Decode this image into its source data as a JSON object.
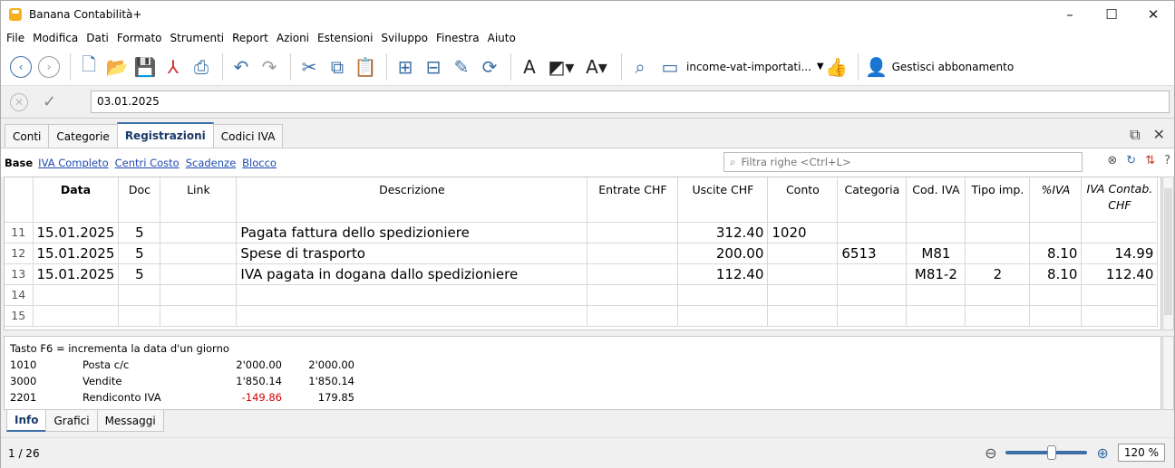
{
  "app": {
    "title": "Banana Contabilità+"
  },
  "window": {
    "minimize": "–",
    "maximize": "☐",
    "close": "✕"
  },
  "menu": [
    "File",
    "Modifica",
    "Dati",
    "Formato",
    "Strumenti",
    "Report",
    "Azioni",
    "Estensioni",
    "Sviluppo",
    "Finestra",
    "Aiuto"
  ],
  "toolbar": {
    "file_dropdown": "income-vat-importati...",
    "manage_subscription": "Gestisci abbonamento"
  },
  "editbar": {
    "value": "03.01.2025"
  },
  "tabs": [
    "Conti",
    "Categorie",
    "Registrazioni",
    "Codici IVA"
  ],
  "active_tab": "Registrazioni",
  "views": {
    "base": "Base",
    "links": [
      "IVA Completo",
      "Centri Costo",
      "Scadenze",
      "Blocco"
    ],
    "filter_placeholder": "Filtra righe <Ctrl+L>"
  },
  "grid": {
    "columns": [
      "Data",
      "Doc",
      "Link",
      "Descrizione",
      "Entrate CHF",
      "Uscite CHF",
      "Conto",
      "Categoria",
      "Cod. IVA",
      "Tipo imp.",
      "%IVA",
      "IVA Contab. CHF"
    ],
    "rows": [
      {
        "n": "11",
        "data": "15.01.2025",
        "doc": "5",
        "link": "",
        "desc": "Pagata fattura dello spedizioniere",
        "entrate": "",
        "uscite": "312.40",
        "conto": "1020",
        "categoria": "",
        "codiva": "",
        "tipo": "",
        "piva": "",
        "ivacontab": ""
      },
      {
        "n": "12",
        "data": "15.01.2025",
        "doc": "5",
        "link": "",
        "desc": "Spese di trasporto",
        "entrate": "",
        "uscite": "200.00",
        "conto": "",
        "categoria": "6513",
        "codiva": "M81",
        "tipo": "",
        "piva": "8.10",
        "ivacontab": "14.99"
      },
      {
        "n": "13",
        "data": "15.01.2025",
        "doc": "5",
        "link": "",
        "desc": "IVA pagata in dogana dallo spedizioniere",
        "entrate": "",
        "uscite": "112.40",
        "conto": "",
        "categoria": "",
        "codiva": "M81-2",
        "tipo": "2",
        "piva": "8.10",
        "ivacontab": "112.40"
      },
      {
        "n": "14",
        "data": "",
        "doc": "",
        "link": "",
        "desc": "",
        "entrate": "",
        "uscite": "",
        "conto": "",
        "categoria": "",
        "codiva": "",
        "tipo": "",
        "piva": "",
        "ivacontab": ""
      },
      {
        "n": "15",
        "data": "",
        "doc": "",
        "link": "",
        "desc": "",
        "entrate": "",
        "uscite": "",
        "conto": "",
        "categoria": "",
        "codiva": "",
        "tipo": "",
        "piva": "",
        "ivacontab": ""
      }
    ]
  },
  "info": {
    "hint": "Tasto F6 = incrementa la data d'un giorno",
    "lines": [
      {
        "acc": "1010",
        "name": "Posta c/c",
        "v1": "2'000.00",
        "v2": "2'000.00",
        "neg": false
      },
      {
        "acc": "3000",
        "name": "Vendite",
        "v1": "1'850.14",
        "v2": "1'850.14",
        "neg": false
      },
      {
        "acc": "2201",
        "name": "Rendiconto IVA",
        "v1": "-149.86",
        "v2": "179.85",
        "neg": true
      }
    ]
  },
  "bottom_tabs": [
    "Info",
    "Grafici",
    "Messaggi"
  ],
  "status": {
    "position": "1 / 26",
    "zoom": "120 %"
  }
}
